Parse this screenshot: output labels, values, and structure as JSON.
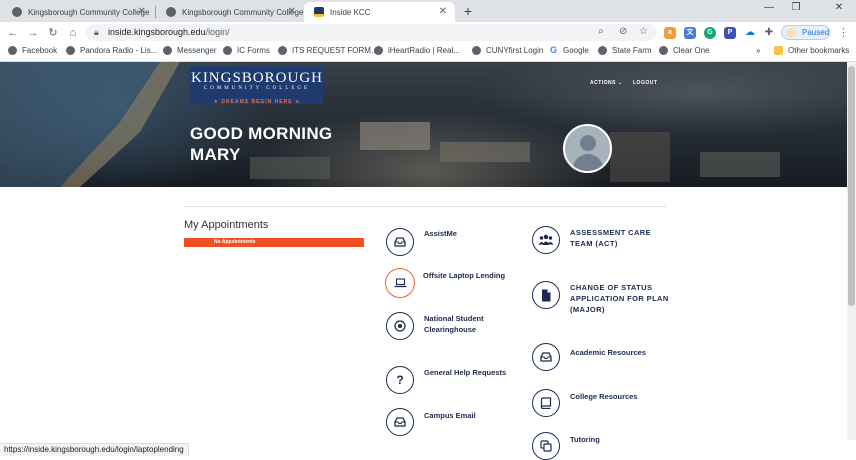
{
  "browser": {
    "tabs": [
      {
        "title": "Kingsborough Community College",
        "active": false
      },
      {
        "title": "Kingsborough Community College",
        "active": false
      },
      {
        "title": "Inside KCC",
        "active": true
      }
    ],
    "url_host": "inside.kingsborough.edu",
    "url_path": "/login/",
    "profile_status": "Paused",
    "bookmarks": [
      "Facebook",
      "Pandora Radio - Lis...",
      "Messenger",
      "IC Forms",
      "ITS REQUEST FORM...",
      "iHeartRadio | Real...",
      "CUNYfirst Login",
      "Google",
      "State Farm",
      "Clear One"
    ],
    "bookmarks_more": "»",
    "other_bookmarks": "Other bookmarks",
    "status_url": "https://inside.kingsborough.edu/login/laptoplending"
  },
  "site": {
    "logo_line1": "KINGSBOROUGH",
    "logo_line2": "COMMUNITY COLLEGE",
    "logo_line3": "★ DREAMS BEGIN HERE ★",
    "nav_actions": "ACTIONS ⌄",
    "nav_logout": "LOGOUT",
    "greeting_line1": "GOOD MORNING",
    "greeting_line2": "MARY"
  },
  "appointments": {
    "title": "My Appointments",
    "empty_text": "No Appointments"
  },
  "tiles_col1": [
    {
      "label": "AssistMe",
      "icon": "inbox-icon"
    },
    {
      "label": "Offsite Laptop Lending",
      "icon": "laptop-icon"
    },
    {
      "label": "National Student Clearinghouse",
      "icon": "target-icon"
    },
    {
      "label": "General Help Requests",
      "icon": "question-icon"
    },
    {
      "label": "Campus Email",
      "icon": "inbox-icon"
    }
  ],
  "tiles_col2": [
    {
      "label": "ASSESSMENT CARE TEAM (ACT)",
      "icon": "people-icon"
    },
    {
      "label": "CHANGE OF STATUS APPLICATION FOR PLAN (MAJOR)",
      "icon": "document-icon"
    },
    {
      "label": "Academic Resources",
      "icon": "inbox-icon"
    },
    {
      "label": "College Resources",
      "icon": "book-icon"
    },
    {
      "label": "Tutoring",
      "icon": "copy-icon"
    }
  ]
}
